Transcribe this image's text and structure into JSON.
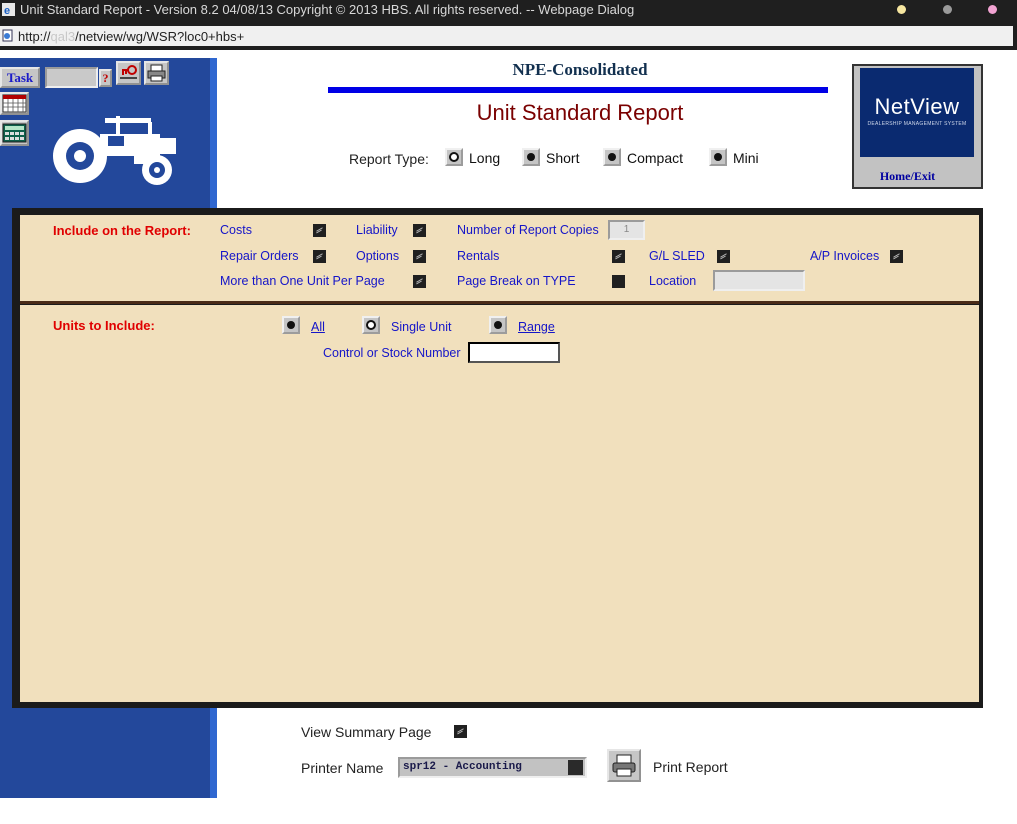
{
  "window": {
    "title": "Unit Standard Report - Version 8.2 04/08/13   Copyright © 2013 HBS. All rights reserved. -- Webpage Dialog",
    "url_prefix": "http://",
    "url_host": "qal3",
    "url_path": "/netview/wg/WSR?loc0+hbs+"
  },
  "toolbar": {
    "task_label": "Task",
    "help_label": "?"
  },
  "header": {
    "company": "NPE-Consolidated",
    "title": "Unit Standard Report",
    "report_type_label": "Report Type:",
    "report_types": [
      {
        "label": "Long",
        "selected": true
      },
      {
        "label": "Short",
        "selected": false
      },
      {
        "label": "Compact",
        "selected": false
      },
      {
        "label": "Mini",
        "selected": false
      }
    ]
  },
  "logo": {
    "brand": "NetView",
    "tagline": "DEALERSHIP MANAGEMENT SYSTEM",
    "home_exit": "Home/Exit"
  },
  "include": {
    "heading": "Include on the Report:",
    "costs": "Costs",
    "liability": "Liability",
    "copies_label": "Number of Report Copies",
    "copies_value": "1",
    "repair_orders": "Repair Orders",
    "options": "Options",
    "rentals": "Rentals",
    "gl_sled": "G/L SLED",
    "ap_invoices": "A/P Invoices",
    "more_units": "More than One Unit Per Page",
    "page_break": "Page Break on TYPE",
    "location": "Location",
    "location_value": ""
  },
  "units": {
    "heading": "Units to Include:",
    "options": [
      {
        "label": "All",
        "selected": false
      },
      {
        "label": "Single Unit",
        "selected": true
      },
      {
        "label": "Range",
        "selected": false
      }
    ],
    "control_label": "Control or Stock Number",
    "control_value": ""
  },
  "bottom": {
    "view_summary": "View Summary Page",
    "printer_label": "Printer Name",
    "printer_value": "spr12 - Accounting",
    "print_report": "Print Report"
  },
  "colors": {
    "accent_blue": "#23489b",
    "panel_tan": "#f1e0bd",
    "title_red": "#7a0000",
    "label_blue": "#1515c8",
    "heading_red": "#e00000"
  }
}
